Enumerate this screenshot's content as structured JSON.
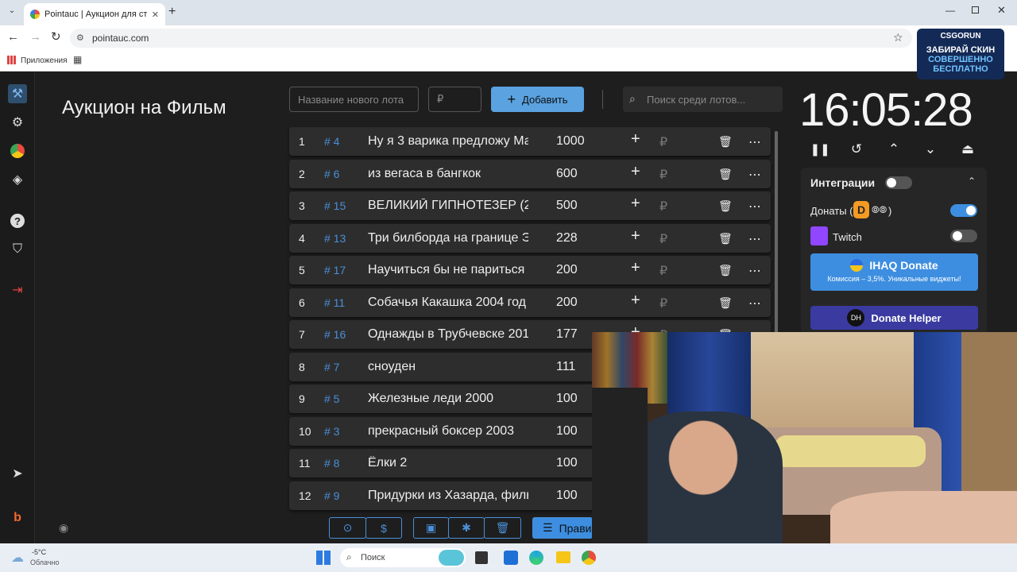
{
  "browser": {
    "tab_title": "Pointauc | Аукцион для стримеров",
    "url": "pointauc.com",
    "bookmarks_label": "Приложения"
  },
  "page": {
    "title": "Аукцион на Фильм",
    "new_lot_placeholder": "Название нового лота",
    "amount_placeholder": "₽",
    "add_label": "Добавить",
    "search_placeholder": "Поиск среди лотов..."
  },
  "lots": [
    {
      "idx": "1",
      "id": "# 4",
      "name": "Ну я 3 варика предложу Ма",
      "amount": "1000"
    },
    {
      "idx": "2",
      "id": "# 6",
      "name": "из вегаса в бангкок",
      "amount": "600"
    },
    {
      "idx": "3",
      "id": "# 15",
      "name": "ВЕЛИКИЙ ГИПНОТЕЗЕР (2(",
      "amount": "500"
    },
    {
      "idx": "4",
      "id": "# 13",
      "name": "Три билборда на границе Э",
      "amount": "228"
    },
    {
      "idx": "5",
      "id": "# 17",
      "name": "Научиться бы не париться",
      "amount": "200"
    },
    {
      "idx": "6",
      "id": "# 11",
      "name": "Собачья Какашка 2004 год",
      "amount": "200"
    },
    {
      "idx": "7",
      "id": "# 16",
      "name": "Однажды в Трубчевске 201",
      "amount": "177"
    },
    {
      "idx": "8",
      "id": "# 7",
      "name": "сноуден",
      "amount": "111"
    },
    {
      "idx": "9",
      "id": "# 5",
      "name": "Железные леди 2000",
      "amount": "100"
    },
    {
      "idx": "10",
      "id": "# 3",
      "name": "прекрасный боксер 2003",
      "amount": "100"
    },
    {
      "idx": "11",
      "id": "# 8",
      "name": "Ёлки 2",
      "amount": "100"
    },
    {
      "idx": "12",
      "id": "# 9",
      "name": "Придурки из Хазарда, филь",
      "amount": "100"
    }
  ],
  "lot_currency": "₽",
  "timer": "16:05:28",
  "integrations": {
    "title": "Интеграции",
    "donations_label": "Донаты (",
    "donations_close": ")",
    "twitch_label": "Twitch",
    "ihaq_title": "IHAQ Donate",
    "ihaq_sub": "Комиссия – 3,5%. Уникальные виджеты!",
    "dh_label": "Donate Helper",
    "dh_badge": "DH"
  },
  "bottom": {
    "rules_label": "Прави"
  },
  "ad": {
    "brand": "CSGORUN",
    "line1": "ЗАБИРАЙ СКИН",
    "line2": "СОВЕРШЕННО",
    "line3": "БЕСПЛАТНО"
  },
  "taskbar": {
    "temp": "-5°C",
    "weather": "Облачно",
    "search_placeholder": "Поиск"
  }
}
